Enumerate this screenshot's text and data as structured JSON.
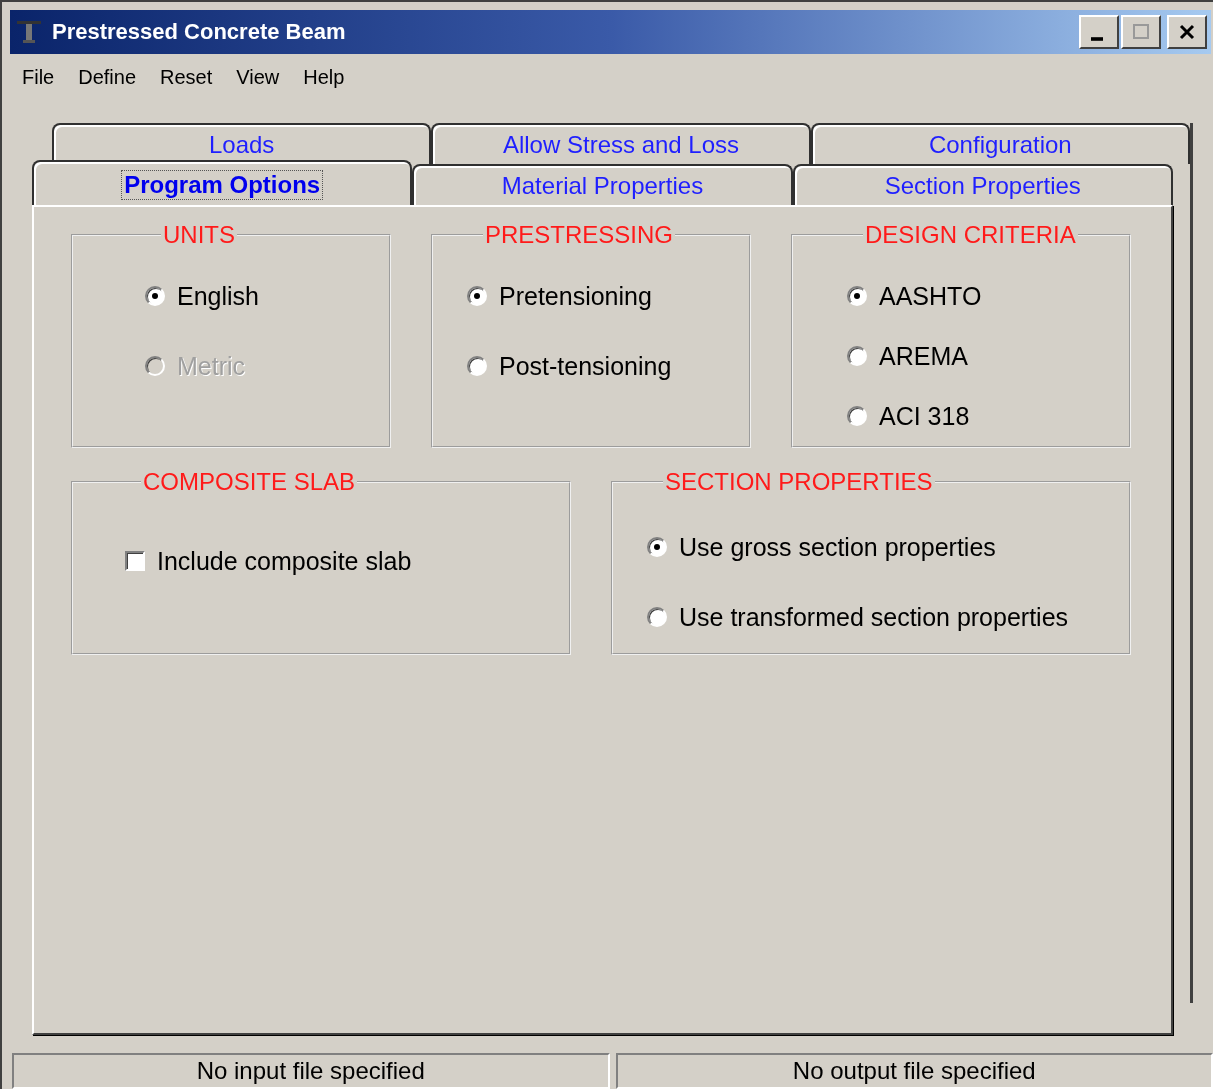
{
  "window": {
    "title": "Prestressed Concrete Beam"
  },
  "menu": [
    "File",
    "Define",
    "Reset",
    "View",
    "Help"
  ],
  "tab_rows": [
    [
      {
        "label": "Loads",
        "selected": false
      },
      {
        "label": "Allow Stress and Loss",
        "selected": false
      },
      {
        "label": "Configuration",
        "selected": false
      }
    ],
    [
      {
        "label": "Program Options",
        "selected": true
      },
      {
        "label": "Material Properties",
        "selected": false
      },
      {
        "label": "Section Properties",
        "selected": false
      }
    ]
  ],
  "groups": [
    {
      "title": "UNITS",
      "options": [
        {
          "kind": "radio",
          "label": "English",
          "selected": true,
          "disabled": false
        },
        {
          "kind": "radio",
          "label": "Metric",
          "selected": false,
          "disabled": true
        }
      ]
    },
    {
      "title": "PRESTRESSING",
      "options": [
        {
          "kind": "radio",
          "label": "Pretensioning",
          "selected": true,
          "disabled": false
        },
        {
          "kind": "radio",
          "label": "Post-tensioning",
          "selected": false,
          "disabled": false
        }
      ]
    },
    {
      "title": "DESIGN CRITERIA",
      "options": [
        {
          "kind": "radio",
          "label": "AASHTO",
          "selected": true,
          "disabled": false
        },
        {
          "kind": "radio",
          "label": "AREMA",
          "selected": false,
          "disabled": false
        },
        {
          "kind": "radio",
          "label": "ACI 318",
          "selected": false,
          "disabled": false
        }
      ]
    },
    {
      "title": "COMPOSITE SLAB",
      "options": [
        {
          "kind": "checkbox",
          "label": "Include composite slab",
          "checked": false
        }
      ]
    },
    {
      "title": "SECTION PROPERTIES",
      "options": [
        {
          "kind": "radio",
          "label": "Use gross section properties",
          "selected": true,
          "disabled": false
        },
        {
          "kind": "radio",
          "label": "Use transformed section properties",
          "selected": false,
          "disabled": false
        }
      ]
    }
  ],
  "status_bar": [
    "No input file specified",
    "No output file specified"
  ]
}
